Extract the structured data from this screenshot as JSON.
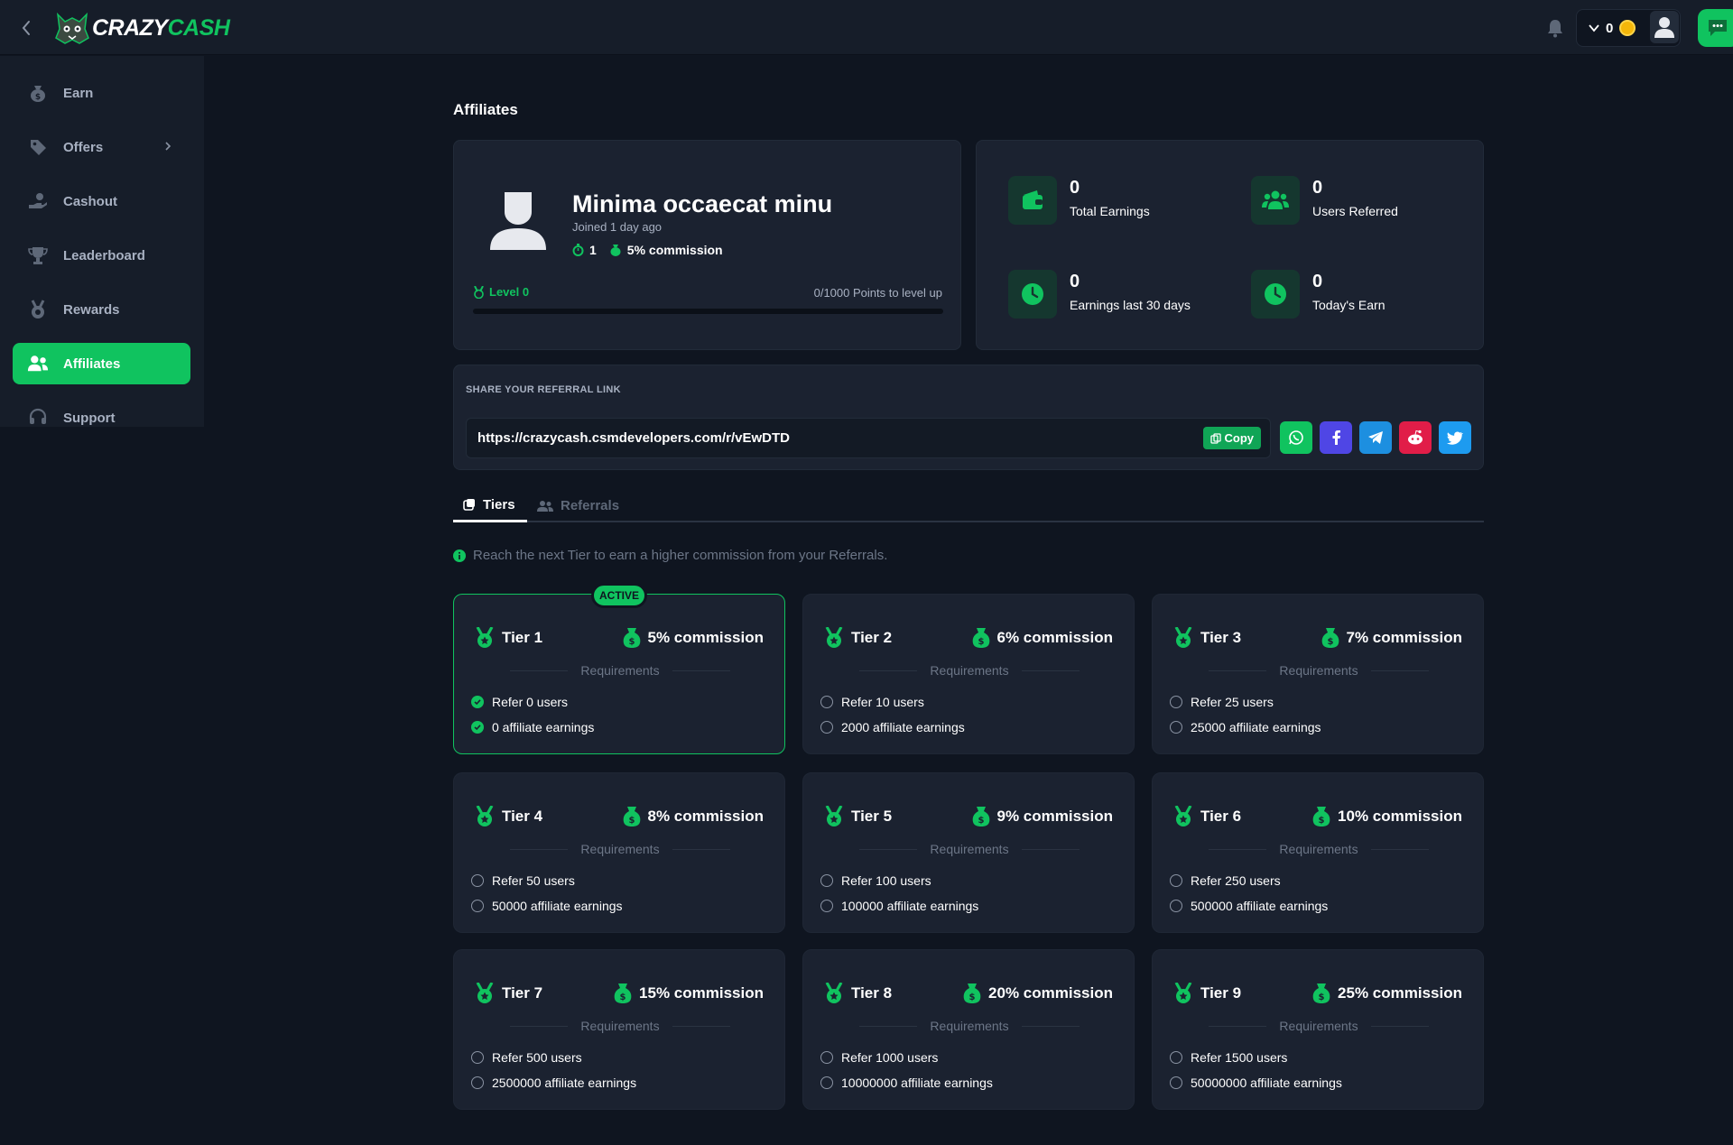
{
  "app": {
    "logo_text_white": "CRAZY",
    "logo_text_green": "CASH",
    "balance": "0"
  },
  "sidebar": {
    "items": [
      {
        "label": "Earn",
        "icon": "money-bag-icon"
      },
      {
        "label": "Offers",
        "icon": "tag-icon"
      },
      {
        "label": "Cashout",
        "icon": "hand-coin-icon"
      },
      {
        "label": "Leaderboard",
        "icon": "trophy-icon"
      },
      {
        "label": "Rewards",
        "icon": "medal-icon"
      },
      {
        "label": "Affiliates",
        "icon": "users-icon",
        "active": true
      },
      {
        "label": "Support",
        "icon": "headset-icon"
      }
    ]
  },
  "page": {
    "title": "Affiliates"
  },
  "profile": {
    "name": "Minima occaecat minu",
    "joined": "Joined 1 day ago",
    "streak": "1",
    "commission": "5% commission",
    "level": "Level 0",
    "points": "0/1000 Points to level up",
    "progress_fraction": 0
  },
  "stats": [
    {
      "value": "0",
      "caption": "Total Earnings",
      "icon": "wallet-icon"
    },
    {
      "value": "0",
      "caption": "Users Referred",
      "icon": "users-icon"
    },
    {
      "value": "0",
      "caption": "Earnings last 30 days",
      "icon": "clock-icon"
    },
    {
      "value": "0",
      "caption": "Today's Earn",
      "icon": "clock-icon"
    }
  ],
  "referral": {
    "title": "SHARE YOUR REFERRAL LINK",
    "url": "https://crazycash.csmdevelopers.com/r/vEwDTD",
    "copy_label": "Copy",
    "share": [
      {
        "name": "whatsapp",
        "color": "#10c35f"
      },
      {
        "name": "facebook",
        "color": "#4f46e5"
      },
      {
        "name": "telegram",
        "color": "#1d8fe0"
      },
      {
        "name": "reddit",
        "color": "#e11d48"
      },
      {
        "name": "twitter",
        "color": "#1d9bf0"
      }
    ]
  },
  "tabs": [
    {
      "label": "Tiers",
      "active": true
    },
    {
      "label": "Referrals",
      "active": false
    }
  ],
  "info_text": "Reach the next Tier to earn a higher commission from your Referrals.",
  "requirements_label": "Requirements",
  "active_label": "ACTIVE",
  "tiers": [
    {
      "name": "Tier 1",
      "commission": "5% commission",
      "req1": "Refer 0 users",
      "req2": "0 affiliate earnings",
      "active": true
    },
    {
      "name": "Tier 2",
      "commission": "6% commission",
      "req1": "Refer 10 users",
      "req2": "2000 affiliate earnings",
      "active": false
    },
    {
      "name": "Tier 3",
      "commission": "7% commission",
      "req1": "Refer 25 users",
      "req2": "25000 affiliate earnings",
      "active": false
    },
    {
      "name": "Tier 4",
      "commission": "8% commission",
      "req1": "Refer 50 users",
      "req2": "50000 affiliate earnings",
      "active": false
    },
    {
      "name": "Tier 5",
      "commission": "9% commission",
      "req1": "Refer 100 users",
      "req2": "100000 affiliate earnings",
      "active": false
    },
    {
      "name": "Tier 6",
      "commission": "10% commission",
      "req1": "Refer 250 users",
      "req2": "500000 affiliate earnings",
      "active": false
    },
    {
      "name": "Tier 7",
      "commission": "15% commission",
      "req1": "Refer 500 users",
      "req2": "2500000 affiliate earnings",
      "active": false
    },
    {
      "name": "Tier 8",
      "commission": "20% commission",
      "req1": "Refer 1000 users",
      "req2": "10000000 affiliate earnings",
      "active": false
    },
    {
      "name": "Tier 9",
      "commission": "25% commission",
      "req1": "Refer 1500 users",
      "req2": "50000000 affiliate earnings",
      "active": false
    }
  ],
  "colors": {
    "accent": "#10c35f",
    "background": "#0f1520",
    "card": "#1b2230"
  }
}
